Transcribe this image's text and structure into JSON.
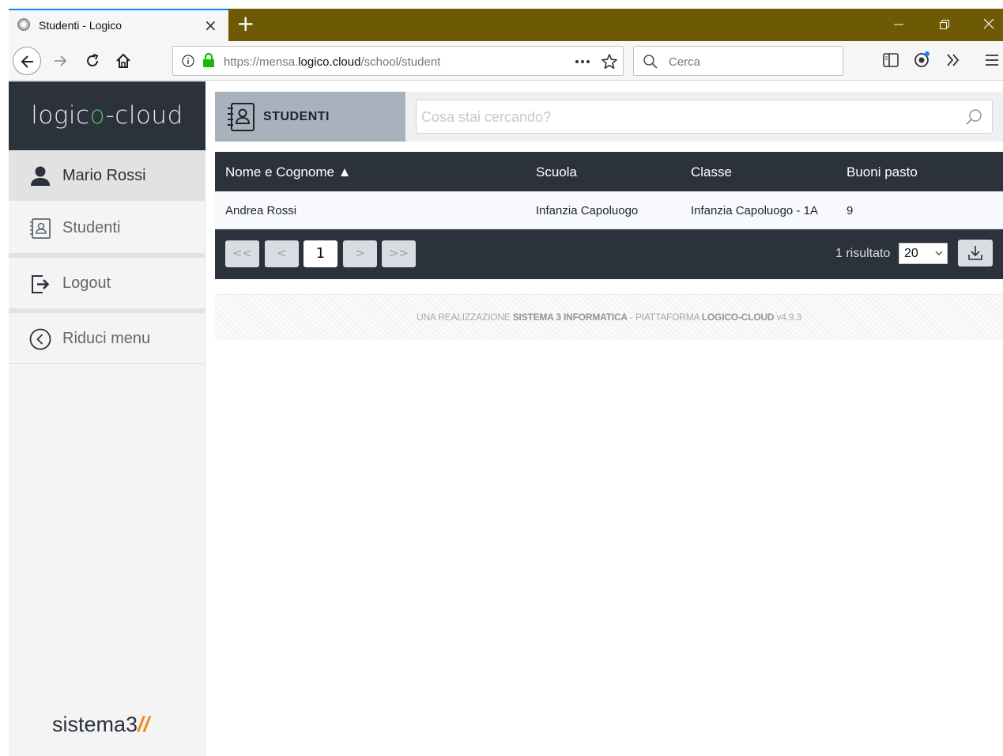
{
  "browser": {
    "tab_title": "Studenti - Logico",
    "tab_close": "×",
    "new_tab": "+",
    "url_prefix": "https://mensa.",
    "url_domain": "logico.cloud",
    "url_path": "/school/student",
    "search_placeholder": "Cerca",
    "accent": "#0a84ff",
    "tabstrip_color": "#6e5a04"
  },
  "app": {
    "brand_part1": "logic",
    "brand_o": "o",
    "brand_part2": "-cloud",
    "brand_accent": "#4ec16b",
    "sidebar": {
      "user_name": "Mario Rossi",
      "items": [
        {
          "label": "Studenti",
          "icon": "students-icon"
        },
        {
          "label": "Logout",
          "icon": "logout-icon"
        },
        {
          "label": "Riduci menu",
          "icon": "chevron-left-circle-icon"
        }
      ],
      "footer_logo_text": "sistema3",
      "footer_logo_mark": "//"
    },
    "page": {
      "title": "STUDENTI",
      "search_placeholder": "Cosa stai cercando?"
    },
    "table": {
      "columns": [
        "Nome e Cognome ▲",
        "Scuola",
        "Classe",
        "Buoni pasto"
      ],
      "rows": [
        [
          "Andrea Rossi",
          "Infanzia Capoluogo",
          "Infanzia Capoluogo - 1A",
          "9"
        ]
      ]
    },
    "pager": {
      "first": "<<",
      "prev": "<",
      "current": "1",
      "next": ">",
      "last": ">>",
      "result_label": "1 risultato",
      "page_size": "20"
    },
    "footer": {
      "p1": "UNA REALIZZAZIONE ",
      "company": "SISTEMA 3 INFORMATICA",
      "p2": " - PIATTAFORMA ",
      "platform": "LOGICO-CLOUD",
      "version": " v4.9.3"
    },
    "dark_color": "#2b323c"
  }
}
